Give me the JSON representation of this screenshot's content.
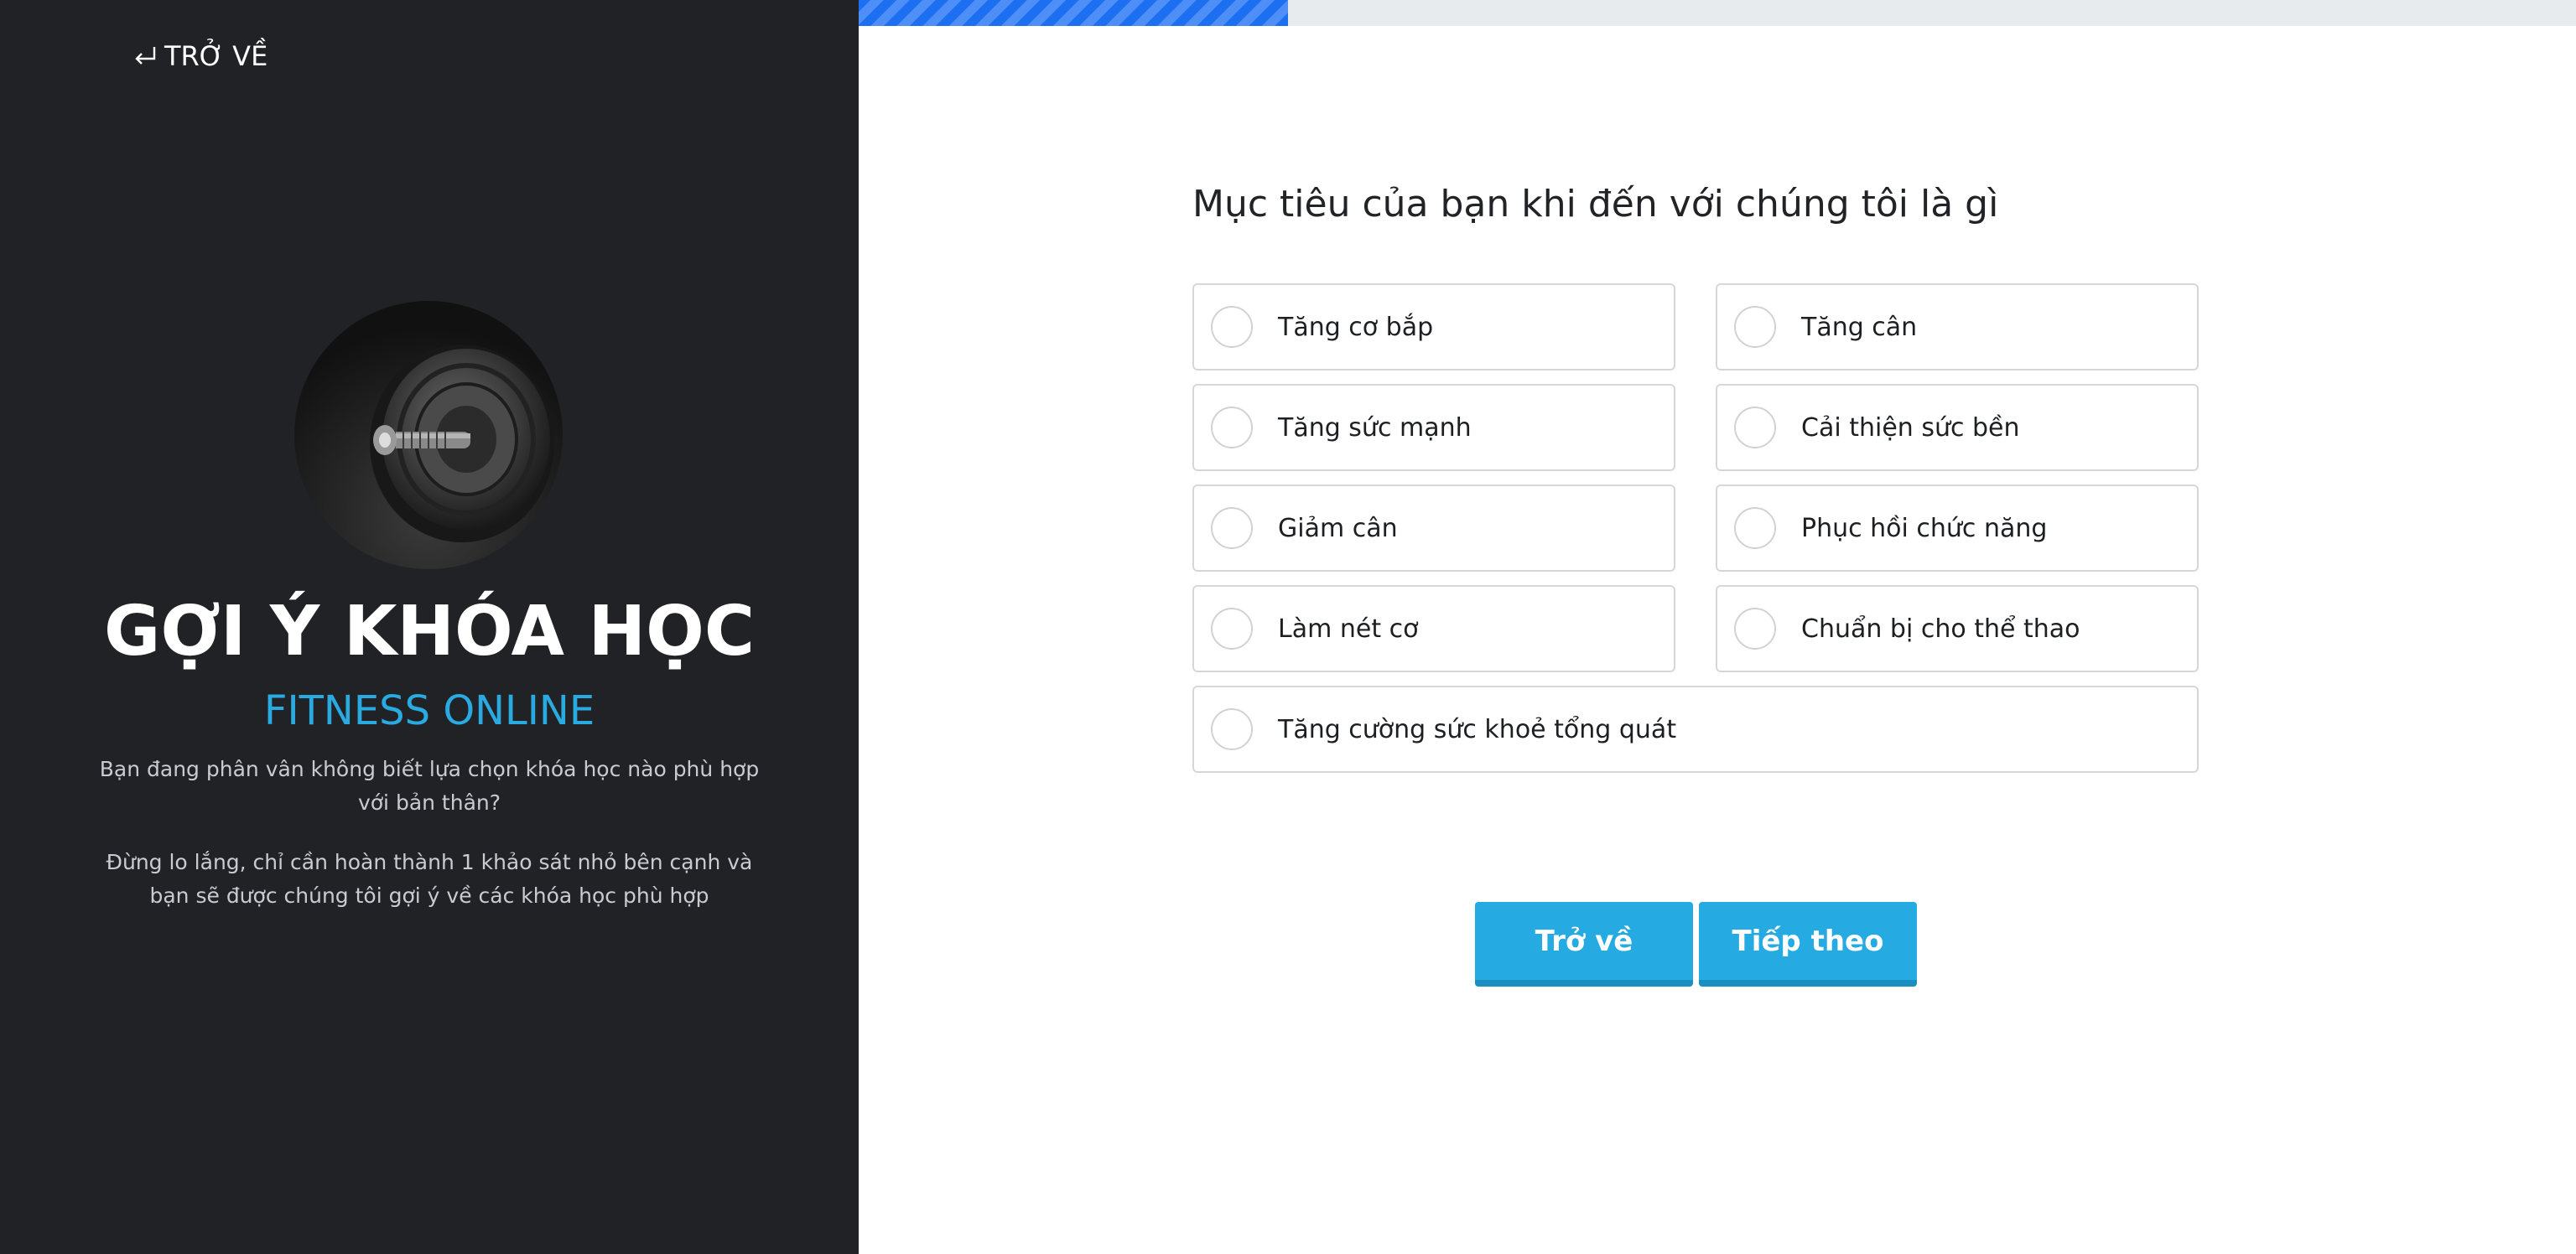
{
  "nav": {
    "back_label": "TRỞ VỀ"
  },
  "hero": {
    "title": "GỢI Ý KHÓA HỌC",
    "subtitle": "FITNESS ONLINE",
    "description_1": "Bạn đang phân vân không biết lựa chọn khóa học nào phù hợp với bản thân?",
    "description_2": "Đừng lo lắng, chỉ cần hoàn thành 1 khảo sát nhỏ bên cạnh và bạn sẽ được chúng tôi gợi ý về các khóa học phù hợp",
    "image": "dumbbell-plate-photo"
  },
  "progress": {
    "fraction": 0.25
  },
  "survey": {
    "question": "Mục tiêu của bạn khi đến với chúng tôi là gì",
    "options": [
      {
        "label": "Tăng cơ bắp",
        "selected": false
      },
      {
        "label": "Tăng cân",
        "selected": false
      },
      {
        "label": "Tăng sức mạnh",
        "selected": false
      },
      {
        "label": "Cải thiện sức bền",
        "selected": false
      },
      {
        "label": "Giảm cân",
        "selected": false
      },
      {
        "label": "Phục hồi chức năng",
        "selected": false
      },
      {
        "label": "Làm nét cơ",
        "selected": false
      },
      {
        "label": "Chuẩn bị cho thể thao",
        "selected": false
      },
      {
        "label": "Tăng cường sức khoẻ tổng quát",
        "selected": false
      }
    ]
  },
  "buttons": {
    "back_label": "Trở về",
    "next_label": "Tiếp theo"
  },
  "colors": {
    "sidebar_bg": "#212226",
    "accent": "#29abe2",
    "progress": "#1d6ff2"
  }
}
